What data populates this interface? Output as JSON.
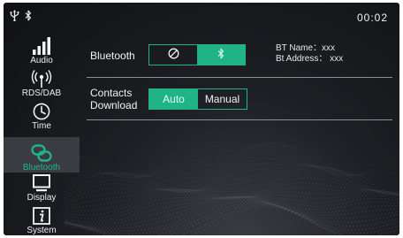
{
  "status_bar": {
    "icons": [
      "usb-icon",
      "bluetooth-icon"
    ],
    "time": "00:02"
  },
  "sidebar": {
    "active": "Bluetooth",
    "items": [
      {
        "label": "Audio",
        "icon": "equalizer-icon"
      },
      {
        "label": "RDS/DAB",
        "icon": "radio-antenna-icon"
      },
      {
        "label": "Time",
        "icon": "clock-icon"
      },
      {
        "label": "Bluetooth",
        "icon": "link-icon"
      },
      {
        "label": "Display",
        "icon": "monitor-icon"
      },
      {
        "label": "System",
        "icon": "info-icon"
      }
    ]
  },
  "settings": {
    "bluetooth": {
      "label": "Bluetooth",
      "off_icon": "disabled-icon",
      "on_icon": "bluetooth-icon",
      "selected": "on",
      "bt_name": "BT Name：xxx",
      "bt_address": "Bt Address： xxx"
    },
    "contacts_download": {
      "label_line1": "Contacts",
      "label_line2": "Download",
      "options": [
        "Auto",
        "Manual"
      ],
      "selected": "Auto"
    }
  },
  "colors": {
    "accent": "#1fb386",
    "background": "#16171b",
    "active_nav": "#3a3c42"
  }
}
